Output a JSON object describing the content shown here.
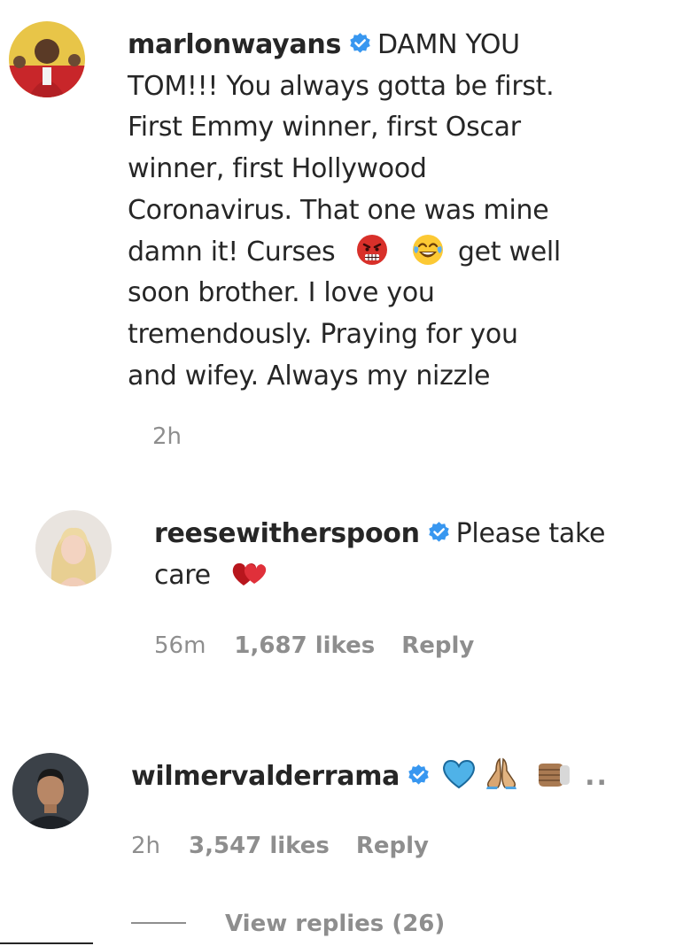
{
  "comments": [
    {
      "username": "marlonwayans",
      "text_lines": [
        "DAMN YOU",
        "TOM!!! You always gotta be first.",
        "First Emmy winner, first Oscar",
        "winner, first Hollywood",
        "Coronavirus. That one was mine",
        "damn it! Curses",
        "get well",
        "soon brother. I love you",
        "tremendously. Praying for you",
        "and wifey. Always my nizzle"
      ],
      "time": "2h"
    },
    {
      "username": "reesewitherspoon",
      "text_line1": "Please take",
      "text_line2": "care",
      "time": "56m",
      "likes": "1,687 likes",
      "reply": "Reply"
    },
    {
      "username": "wilmervalderrama",
      "more": "..",
      "time": "2h",
      "likes": "3,547 likes",
      "reply": "Reply"
    }
  ],
  "view_replies": "View replies (26)",
  "colors": {
    "text": "#262626",
    "secondary": "#8e8e8e",
    "verified": "#3897f0"
  },
  "icons": [
    "verified-badge-icon",
    "enraged-face-emoji",
    "tears-of-joy-emoji",
    "red-hearts-emoji",
    "blue-heart-emoji",
    "folded-hands-emoji",
    "fist-emoji"
  ]
}
